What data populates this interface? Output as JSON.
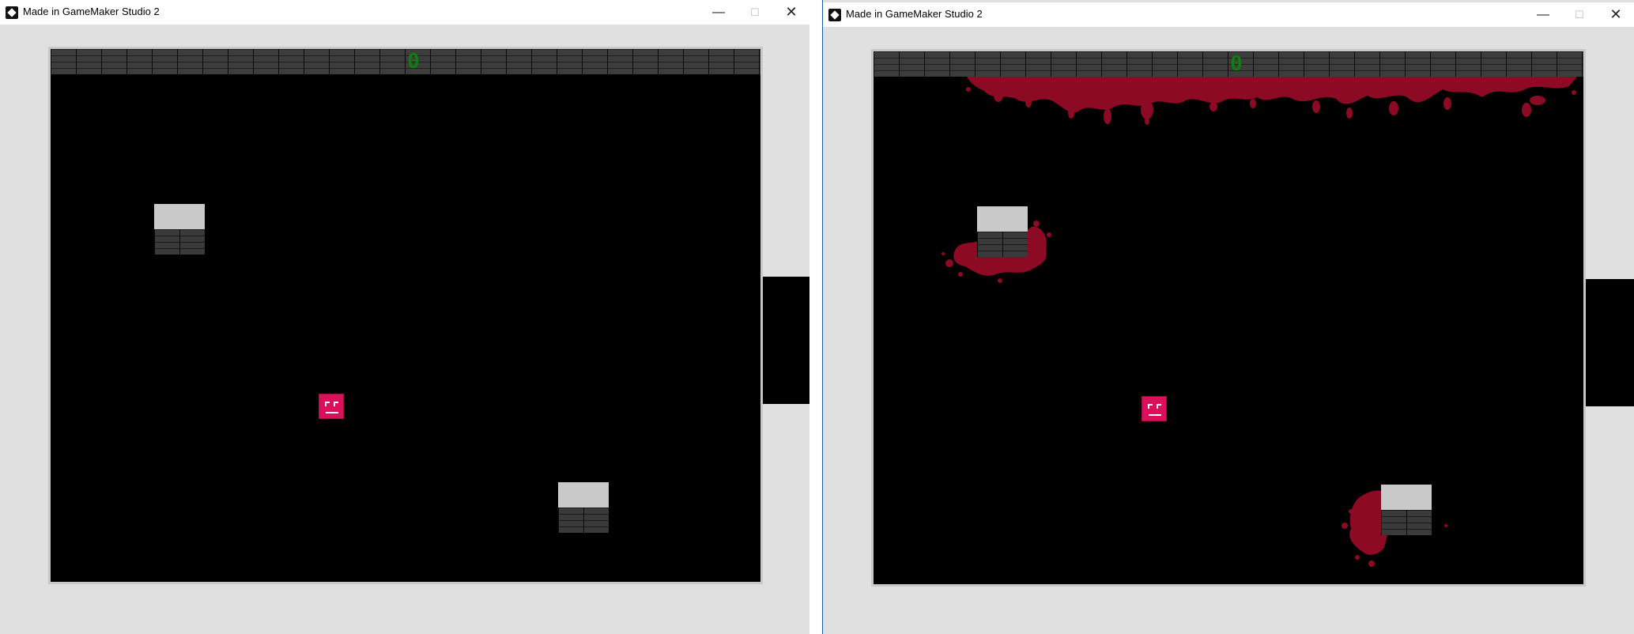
{
  "windows": [
    {
      "id": "window-left",
      "title": "Made in GameMaker Studio 2",
      "controls": {
        "minimize": "—",
        "maximize": "☐",
        "close": "✕"
      },
      "hud": {
        "score": "0",
        "score_color": "#0f7d0f"
      },
      "player": {
        "face": "happy",
        "color": "#db0f5a"
      },
      "blocks": 2,
      "blood": "none"
    },
    {
      "id": "window-right",
      "title": "Made in GameMaker Studio 2",
      "controls": {
        "minimize": "—",
        "maximize": "☐",
        "close": "✕"
      },
      "hud": {
        "score": "0",
        "score_color": "#0f7d0f"
      },
      "player": {
        "face": "happy",
        "color": "#db0f5a"
      },
      "blocks": 2,
      "blood": "splatter",
      "blood_color": "#8c0a24"
    }
  ],
  "colors": {
    "room_background": "#000000",
    "window_background": "#e0e0e0",
    "block_top": "#c9c9c9",
    "brick": "#3d3d3d"
  }
}
